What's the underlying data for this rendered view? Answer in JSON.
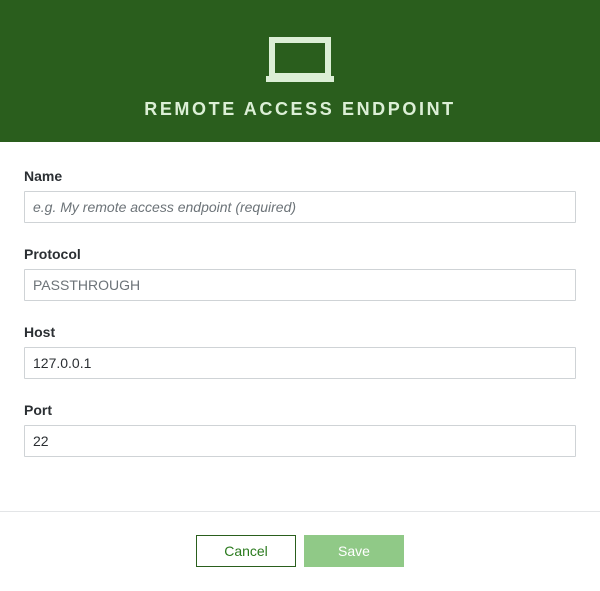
{
  "header": {
    "title": "REMOTE ACCESS ENDPOINT",
    "icon": "laptop-icon",
    "background_color": "#2a5e1d",
    "title_color": "#dcefd6"
  },
  "form": {
    "name": {
      "label": "Name",
      "value": "",
      "placeholder": "e.g. My remote access endpoint (required)"
    },
    "protocol": {
      "label": "Protocol",
      "value": "PASSTHROUGH"
    },
    "host": {
      "label": "Host",
      "value": "127.0.0.1"
    },
    "port": {
      "label": "Port",
      "value": "22"
    }
  },
  "footer": {
    "cancel_label": "Cancel",
    "save_label": "Save",
    "accent_color": "#2a7a1d",
    "save_disabled_color": "#90c987"
  }
}
